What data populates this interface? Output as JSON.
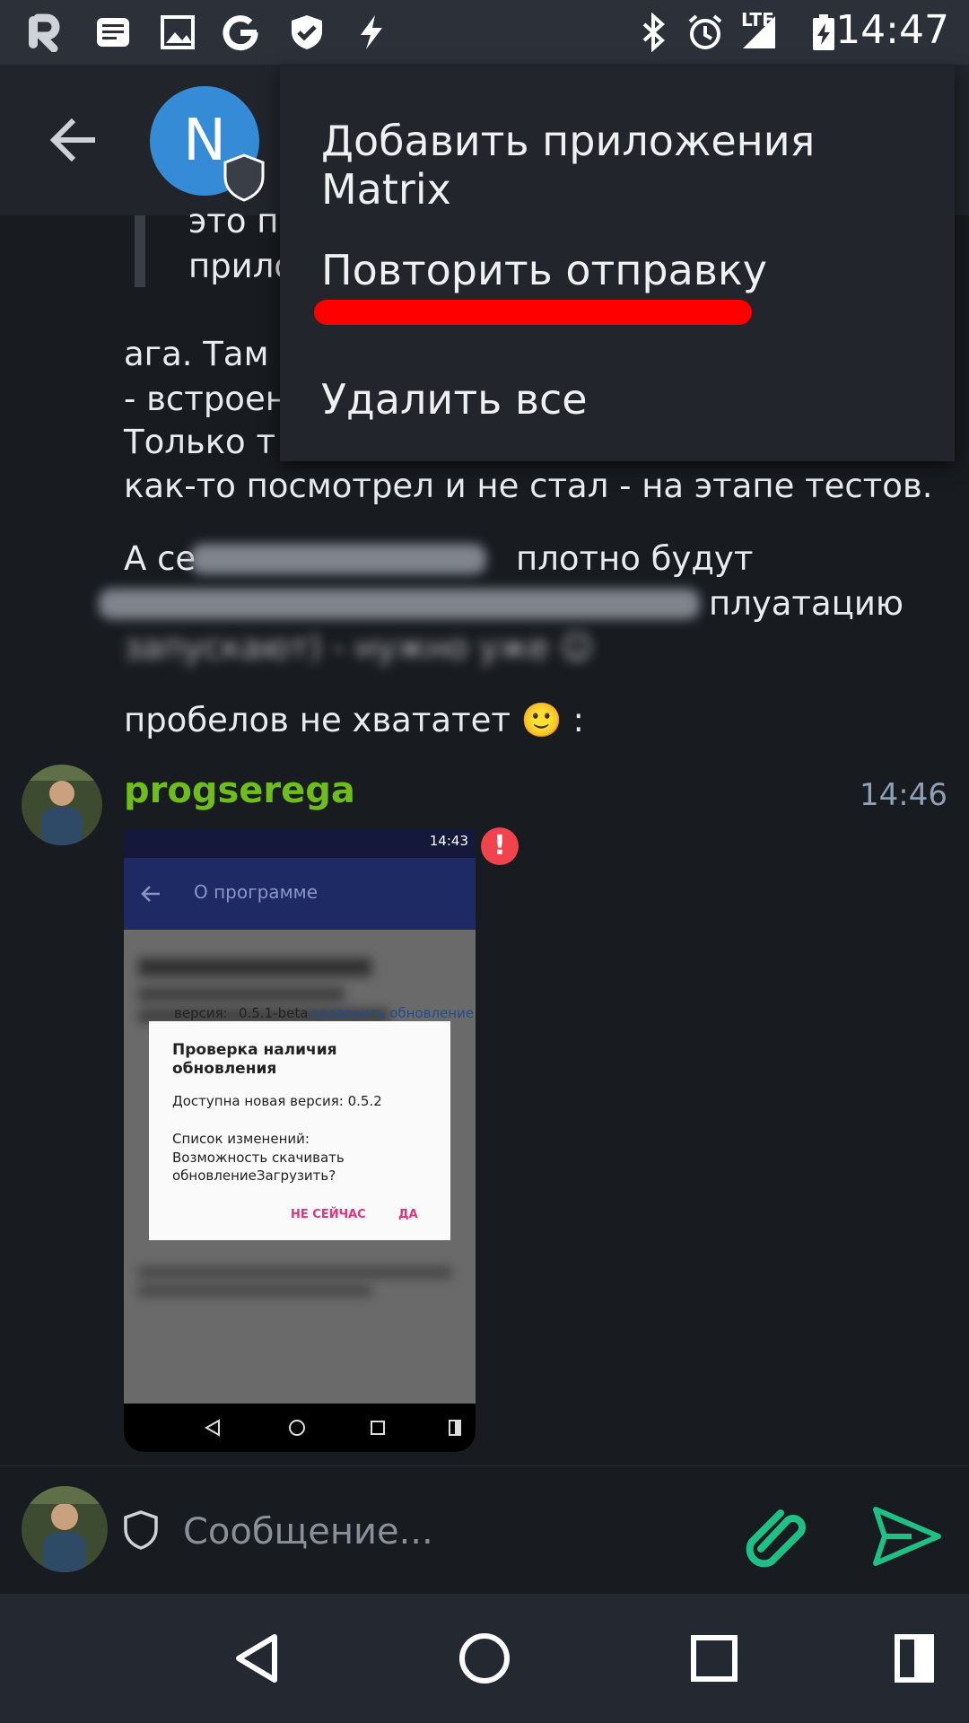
{
  "status_bar": {
    "time": "14:47",
    "network_label": "LTE",
    "left_icons": [
      "riot-icon",
      "notes-icon",
      "image-icon",
      "google-icon",
      "shield-check-icon",
      "flash-icon"
    ],
    "right_icons": [
      "bluetooth-icon",
      "alarm-icon",
      "signal-icon",
      "battery-icon"
    ]
  },
  "header": {
    "room_avatar_letter": "N"
  },
  "context_menu": {
    "items": [
      "Добавить приложения Matrix",
      "Повторить отправку",
      "Удалить все"
    ],
    "highlight_color": "#ff0000"
  },
  "chat": {
    "quote_lines": [
      "это п",
      "прило"
    ],
    "paragraph1_lines": [
      "ага. Там",
      "- встроен",
      "Только т",
      "как-то посмотрел и не стал - на этапе тестов."
    ],
    "paragraph2_lines": [
      "А се",
      "отно будут",
      "плуатацию",
      "- нужно уже"
    ],
    "paragraph2_visible_prefix": "А се",
    "paragraph2_visible_suffix": "плотно будут",
    "paragraph2_line2_suffix": "плуатацию",
    "paragraph2_line3": "запускают) - нужно уже ☺",
    "paragraph3": "пробелов не хватат",
    "paragraph3_full": "пробелов не хвататет 🙂 :",
    "message": {
      "sender": "progserega",
      "time": "14:46",
      "sender_color": "#6fbc1e"
    },
    "attachment": {
      "status_time": "14:43",
      "toolbar_title": "О программе",
      "version_label": "версия:",
      "version_value": "0.5.1-beta",
      "check_update_link": "проверить обновление",
      "dialog_title": "Проверка наличия обновления",
      "dialog_available": "Доступна новая версия: 0.5.2",
      "dialog_changes_label": "Список изменений:",
      "dialog_changes_text": "Возможность скачивать обновлениеЗагрузить?",
      "dialog_btn_later": "НЕ СЕЙЧАС",
      "dialog_btn_yes": "ДА"
    }
  },
  "composer": {
    "placeholder": "Сообщение..."
  },
  "colors": {
    "accent_green": "#1fbf86",
    "error_red": "#f0434e",
    "room_avatar": "#368bd6"
  }
}
